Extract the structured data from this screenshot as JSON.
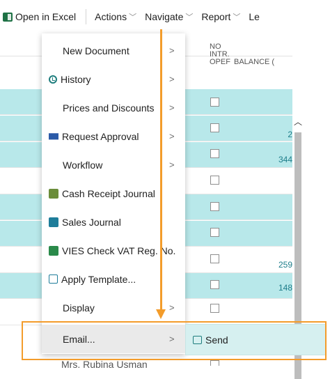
{
  "actionbar": {
    "open_excel": "Open in Excel",
    "actions": "Actions",
    "navigate": "Navigate",
    "report": "Report",
    "cut_item": "Le"
  },
  "columns": {
    "no_intra": [
      "NO",
      "INTR.",
      "OPEF"
    ],
    "balance": "BALANCE ("
  },
  "balances": [
    "2",
    "344",
    "259",
    "148"
  ],
  "menu": {
    "items": [
      {
        "label": "New Document",
        "icon": "",
        "submenu": true
      },
      {
        "label": "History",
        "icon": "history-icon",
        "submenu": true
      },
      {
        "label": "Prices and Discounts",
        "icon": "",
        "submenu": true
      },
      {
        "label": "Request Approval",
        "icon": "request-approval-icon",
        "submenu": true
      },
      {
        "label": "Workflow",
        "icon": "",
        "submenu": true
      },
      {
        "label": "Cash Receipt Journal",
        "icon": "cash-receipt-journal-icon",
        "submenu": false
      },
      {
        "label": "Sales Journal",
        "icon": "sales-journal-icon",
        "submenu": false
      },
      {
        "label": "VIES Check VAT Reg. No.",
        "icon": "vies-check-icon",
        "submenu": false
      },
      {
        "label": "Apply Template...",
        "icon": "apply-template-icon",
        "submenu": false
      },
      {
        "label": "Display",
        "icon": "",
        "submenu": true
      },
      {
        "label": "Email...",
        "icon": "",
        "submenu": true
      }
    ]
  },
  "submenu": {
    "send": "Send"
  },
  "below_row": {
    "name": "Mrs. Rubina Usman"
  },
  "colors": {
    "accent_orange": "#f39c2b",
    "selected_row": "#b8e8ea",
    "submenu_bg": "#d6f0f0"
  }
}
